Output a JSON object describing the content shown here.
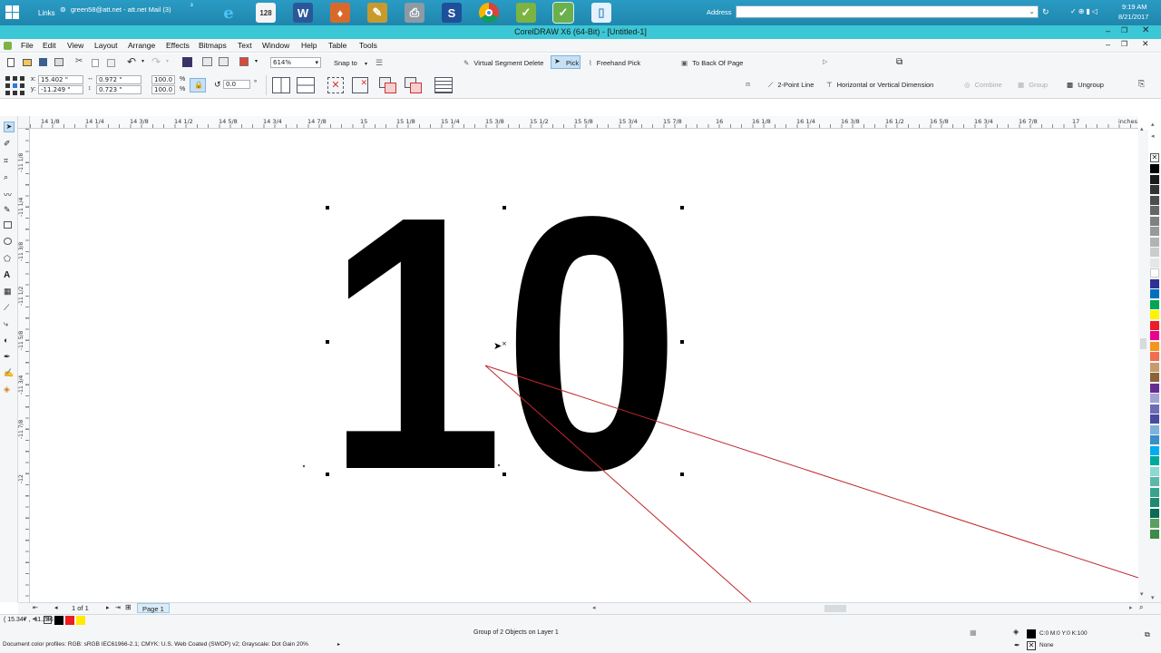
{
  "taskbar": {
    "links_label": "Links",
    "mail_title": "green58@att.net - att.net Mail (3)",
    "mail_badge": "³",
    "address_label": "Address",
    "time": "9:19 AM",
    "date": "8/21/2017",
    "pinned_apps": [
      "internet-explorer",
      "calendar-app",
      "word",
      "app-orange",
      "app-pen",
      "printer-app",
      "skype",
      "chrome",
      "green-app",
      "coreldraw",
      "notepad"
    ]
  },
  "window": {
    "title": "CorelDRAW X6 (64-Bit) - [Untitled-1]"
  },
  "menu": [
    "File",
    "Edit",
    "View",
    "Layout",
    "Arrange",
    "Effects",
    "Bitmaps",
    "Text",
    "Window",
    "Help",
    "Table",
    "Tools"
  ],
  "standard_toolbar": {
    "zoom": "614%",
    "snap_to": "Snap to",
    "virtual_segment_delete": "Virtual Segment Delete",
    "pick": "Pick",
    "freehand_pick": "Freehand Pick",
    "to_back_of_page": "To Back Of Page"
  },
  "property_bar": {
    "x": "15.402 \"",
    "y": "-11.249 \"",
    "width": "0.972 \"",
    "height": "0.723 \"",
    "scale_x": "100.0",
    "scale_y": "100.0",
    "percent": "%",
    "rotation": "0.0",
    "degree": "°",
    "two_point_line": "2-Point Line",
    "hv_dimension": "Horizontal or Vertical Dimension",
    "combine": "Combine",
    "group": "Group",
    "ungroup": "Ungroup"
  },
  "ruler": {
    "h_labels": [
      "14 1/8",
      "14 1/4",
      "14 3/8",
      "14 1/2",
      "14 5/8",
      "14 3/4",
      "14 7/8",
      "15",
      "15 1/8",
      "15 1/4",
      "15 3/8",
      "15 1/2",
      "15 5/8",
      "15 3/4",
      "15 7/8",
      "16",
      "16 1/8",
      "16 1/4",
      "16 3/8",
      "16 1/2",
      "16 5/8",
      "16 3/4",
      "16 7/8",
      "17"
    ],
    "unit": "inches",
    "v_labels": [
      "-11 1/8",
      "-11 1/4",
      "-11 3/8",
      "-11 1/2",
      "-11 5/8",
      "-11 3/4",
      "-11 7/8",
      "-12"
    ]
  },
  "canvas": {
    "artwork_text": "10"
  },
  "page_nav": {
    "page_count": "1 of 1",
    "page_tab": "Page 1"
  },
  "status": {
    "cursor_position": "( 15.347 , -11.236 )",
    "selection_info": "Group of 2 Objects on Layer 1",
    "fill_info": "C:0 M:0 Y:0 K:100",
    "outline_info": "None",
    "color_profiles": "Document color profiles: RGB: sRGB IEC61966-2.1; CMYK: U.S. Web Coated (SWOP) v2; Grayscale: Dot Gain 20%"
  },
  "palette_colors": [
    "#000000",
    "#1a1a1a",
    "#333333",
    "#4d4d4d",
    "#666666",
    "#808080",
    "#999999",
    "#b3b3b3",
    "#cccccc",
    "#e6e6e6",
    "#ffffff",
    "#2e3192",
    "#0072bc",
    "#00a651",
    "#fff200",
    "#ed1c24",
    "#ec008c",
    "#f7941d",
    "#f26c4f",
    "#c69c6d",
    "#8c6239",
    "#662d91",
    "#a3a3d1",
    "#6d6db5",
    "#4a4a9e",
    "#7fb2d8",
    "#3a8fc7",
    "#00aeef",
    "#00a99d",
    "#8ed8cf",
    "#5cb8a8",
    "#39a38e",
    "#1f8a6e",
    "#0b6b53",
    "#5aa061",
    "#3c8c48"
  ],
  "colors": {
    "title_bar": "#3bc7d6",
    "taskbar": "#1f86ad",
    "guide_line": "#c0272d",
    "status_fill": "#000000",
    "quick_swatches": [
      "#000000",
      "#ed1c24",
      "#ffea00"
    ]
  }
}
